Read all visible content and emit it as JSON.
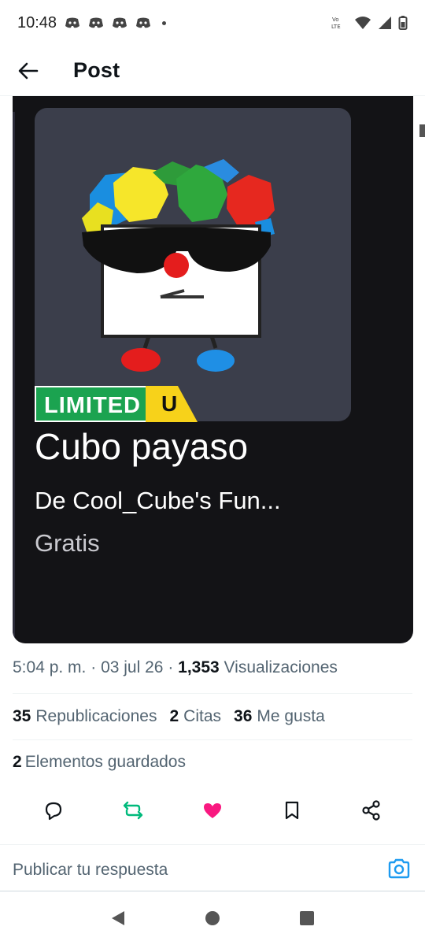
{
  "status_bar": {
    "time": "10:48",
    "notification_icons": [
      "discord-icon",
      "discord-icon",
      "discord-icon",
      "discord-icon"
    ],
    "network_label": "Vo LTE"
  },
  "header": {
    "title": "Post",
    "back_icon": "arrow-left-icon"
  },
  "media": {
    "badge_limited": "LIMITED",
    "badge_u": "U",
    "item_name": "Cubo payaso",
    "item_by": "De Cool_Cube's Fun...",
    "item_price": "Gratis"
  },
  "meta": {
    "time": "5:04 p. m.",
    "date": "03 jul 26",
    "views_count": "1,353",
    "views_label": "Visualizaciones"
  },
  "stats": {
    "reposts_count": "35",
    "reposts_label": "Republicaciones",
    "quotes_count": "2",
    "quotes_label": "Citas",
    "likes_count": "36",
    "likes_label": "Me gusta",
    "bookmarks_count": "2",
    "bookmarks_label": "Elementos guardados"
  },
  "actions": {
    "reply_icon": "comment-icon",
    "repost_icon": "repost-icon",
    "like_icon": "heart-icon",
    "bookmark_icon": "bookmark-icon",
    "share_icon": "share-icon",
    "repost_color": "#00ba7c",
    "like_color": "#f91880"
  },
  "reply": {
    "placeholder": "Publicar tu respuesta",
    "camera_icon": "camera-icon",
    "accent": "#1d9bf0"
  },
  "navbar": {
    "back": "back-triangle-icon",
    "home": "home-circle-icon",
    "recents": "recents-square-icon"
  }
}
